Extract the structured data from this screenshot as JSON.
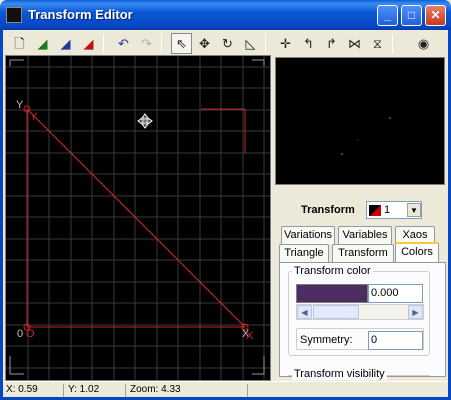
{
  "window": {
    "title": "Transform Editor"
  },
  "titlebar_buttons": {
    "minimize": "_",
    "maximize": "□",
    "close": "✕"
  },
  "toolbar": {
    "icons": [
      "new-icon",
      "add-transform-icon",
      "duplicate-transform-icon",
      "delete-transform-icon",
      "undo-icon",
      "redo-icon",
      "select-icon",
      "move-icon",
      "rotate-icon",
      "scale-icon",
      "reset-icon",
      "rotate-left-icon",
      "rotate-right-icon",
      "flip-horizontal-icon",
      "flip-vertical-icon",
      "preview-toggle-icon"
    ]
  },
  "canvas": {
    "axis_labels": {
      "origin": "0",
      "origin_alt": "O",
      "x": "X",
      "y": "Y"
    },
    "colors": {
      "grid": "#3a3a3a",
      "transform": "#cc2222",
      "reference": "#bdbdbd"
    }
  },
  "transform_selector": {
    "label": "Transform",
    "value": "1"
  },
  "tabs_row1": [
    "Variations",
    "Variables",
    "Xaos"
  ],
  "tabs_row2": [
    "Triangle",
    "Transform",
    "Colors"
  ],
  "active_tab": "Colors",
  "colors_tab": {
    "group_title": "Transform color",
    "color_value": "0.000",
    "swatch_color": "#4d2e62",
    "symmetry_label": "Symmetry:",
    "symmetry_value": "0",
    "next_group_title": "Transform visibility"
  },
  "status": {
    "x": "X: 0.59",
    "y": "Y: 1.02",
    "zoom": "Zoom: 4.33"
  }
}
